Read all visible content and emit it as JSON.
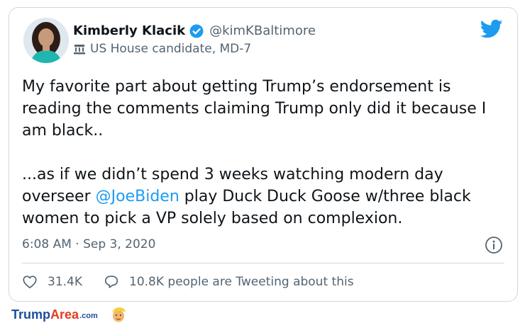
{
  "tweet": {
    "display_name": "Kimberly Klacik",
    "handle": "@kimKBaltimore",
    "account_label": "US House candidate, MD-7",
    "text_lines": [
      "My favorite part about getting Trump’s endorsement is",
      "reading the comments claiming Trump only did it because I",
      "am black..",
      "",
      "...as if we didn’t spend 3 weeks watching modern day"
    ],
    "line6_before": "overseer ",
    "mention": "@JoeBiden",
    "line6_after": " play Duck Duck Goose w/three black",
    "line7": "women to pick a VP solely based on complexion.",
    "timestamp": "6:08 AM · Sep 3, 2020"
  },
  "actions": {
    "likes": "31.4K",
    "conversation": "10.8K people are Tweeting about this"
  },
  "watermark": {
    "part1": "Trump",
    "part2": "Area",
    "part3": ".com"
  },
  "colors": {
    "accent": "#1d9bf0",
    "secondary_text": "#536471",
    "border": "#cfd9de",
    "watermark_blue": "#1c4f9c",
    "watermark_red": "#e23b22"
  },
  "icons": [
    "verified-badge-icon",
    "building-icon",
    "twitter-bird-icon",
    "info-icon",
    "heart-icon",
    "speech-bubble-icon",
    "trump-face-icon"
  ]
}
